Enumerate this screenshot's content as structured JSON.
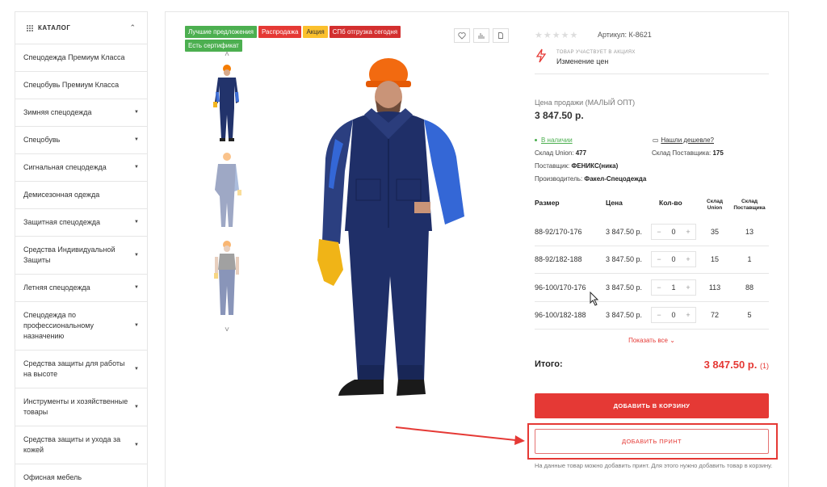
{
  "catalog": {
    "title": "КАТАЛОГ",
    "items": [
      {
        "label": "Спецодежда Премиум Класса",
        "has_sub": false
      },
      {
        "label": "Спецобувь Премиум Класса",
        "has_sub": false
      },
      {
        "label": "Зимняя спецодежда",
        "has_sub": true
      },
      {
        "label": "Спецобувь",
        "has_sub": true
      },
      {
        "label": "Сигнальная спецодежда",
        "has_sub": true
      },
      {
        "label": "Демисезонная одежда",
        "has_sub": false
      },
      {
        "label": "Защитная спецодежда",
        "has_sub": true
      },
      {
        "label": "Средства Индивидуальной Защиты",
        "has_sub": true
      },
      {
        "label": "Летняя спецодежда",
        "has_sub": true
      },
      {
        "label": "Спецодежда по профессиональному назначению",
        "has_sub": true
      },
      {
        "label": "Средства защиты для работы на высоте",
        "has_sub": true
      },
      {
        "label": "Инструменты и хозяйственные товары",
        "has_sub": true
      },
      {
        "label": "Средства защиты и ухода за кожей",
        "has_sub": true
      },
      {
        "label": "Офисная мебель",
        "has_sub": false
      }
    ]
  },
  "badges": [
    {
      "label": "Лучшие предложения",
      "color": "#4caf50"
    },
    {
      "label": "Распродажа",
      "color": "#e53935"
    },
    {
      "label": "Акция",
      "color": "#fbc02d",
      "text_color": "#333"
    },
    {
      "label": "СПб отгрузка сегодня",
      "color": "#d32f2f"
    },
    {
      "label": "Есть сертификат",
      "color": "#4caf50"
    }
  ],
  "product": {
    "sku": "Артикул: К-8621",
    "promo_small": "ТОВАР УЧАСТВУЕТ В АКЦИЯХ",
    "promo_big": "Изменение цен",
    "price_label": "Цена продажи (МАЛЫЙ ОПТ)",
    "price": "3 847.50 р.",
    "in_stock": "В наличии",
    "cheaper": "Нашли дешевле?",
    "stock_union_label": "Склад Union:",
    "stock_union": "477",
    "stock_supplier_label": "Склад Поставщика:",
    "stock_supplier": "175",
    "supplier_label": "Поставщик:",
    "supplier": "ФЕНИКС(ника)",
    "maker_label": "Производитель:",
    "maker": "Факел-Спецодежда"
  },
  "table": {
    "headers": {
      "size": "Размер",
      "price": "Цена",
      "qty": "Кол-во",
      "union": "Склад Union",
      "supplier": "Склад Поставщика"
    },
    "rows": [
      {
        "size": "88-92/170-176",
        "price": "3 847.50 р.",
        "qty": "0",
        "union": "35",
        "supplier": "13"
      },
      {
        "size": "88-92/182-188",
        "price": "3 847.50 р.",
        "qty": "0",
        "union": "15",
        "supplier": "1"
      },
      {
        "size": "96-100/170-176",
        "price": "3 847.50 р.",
        "qty": "1",
        "union": "113",
        "supplier": "88"
      },
      {
        "size": "96-100/182-188",
        "price": "3 847.50 р.",
        "qty": "0",
        "union": "72",
        "supplier": "5"
      }
    ],
    "show_all": "Показать все"
  },
  "total": {
    "label": "Итого:",
    "amount": "3 847.50 р.",
    "count": "(1)"
  },
  "buttons": {
    "cart": "ДОБАВИТЬ В КОРЗИНУ",
    "print": "ДОБАВИТЬ ПРИНТ"
  },
  "note": "На данные товар можно добавить принт. Для этого нужно добавить товар в корзину."
}
